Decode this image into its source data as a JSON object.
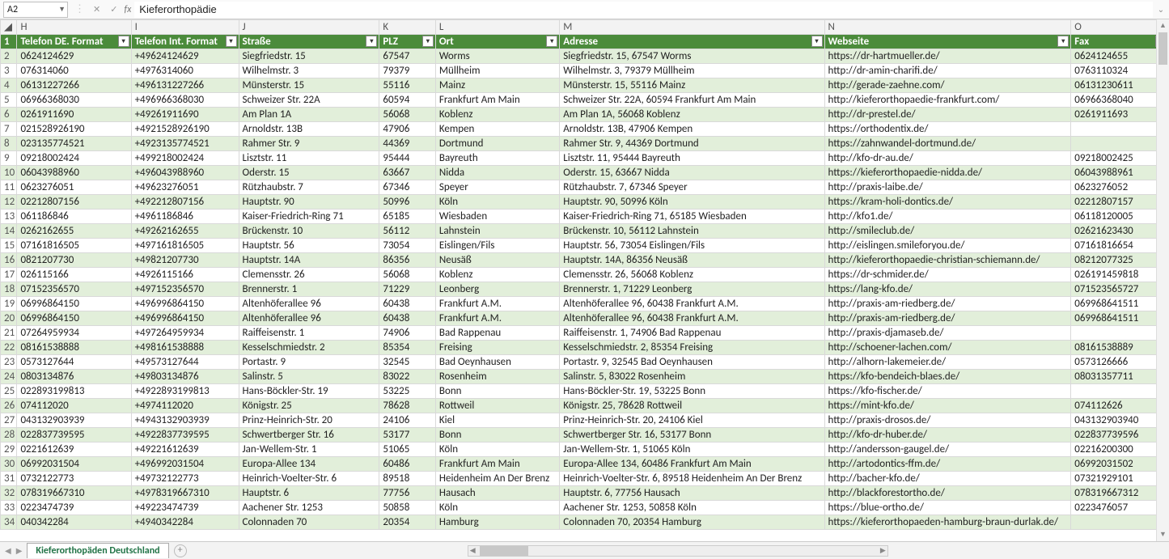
{
  "name_box": "A2",
  "formula_value": "Kieferorthopädie",
  "sheet_tab": "Kieferorthopäden Deutschland",
  "column_letters": [
    "H",
    "I",
    "J",
    "K",
    "L",
    "M",
    "N",
    "O"
  ],
  "headers": {
    "H": "Telefon DE. Format",
    "I": "Telefon Int. Format",
    "J": "Straße",
    "K": "PLZ",
    "L": "Ort",
    "M": "Adresse",
    "N": "Webseite",
    "O": "Fax"
  },
  "rows": [
    {
      "n": 2,
      "H": "0624124629",
      "I": "+49624124629",
      "J": "Siegfriedstr. 15",
      "K": "67547",
      "L": "Worms",
      "M": "Siegfriedstr. 15, 67547 Worms",
      "N": "https://dr-hartmueller.de/",
      "O": "0624124655"
    },
    {
      "n": 3,
      "H": "076314060",
      "I": "+4976314060",
      "J": "Wilhelmstr. 3",
      "K": "79379",
      "L": "Müllheim",
      "M": "Wilhelmstr. 3, 79379 Müllheim",
      "N": "http://dr-amin-charifi.de/",
      "O": "0763110324"
    },
    {
      "n": 4,
      "H": "06131227266",
      "I": "+496131227266",
      "J": "Münsterstr. 15",
      "K": "55116",
      "L": "Mainz",
      "M": "Münsterstr. 15, 55116 Mainz",
      "N": "http://gerade-zaehne.com/",
      "O": "06131230611"
    },
    {
      "n": 5,
      "H": "06966368030",
      "I": "+496966368030",
      "J": "Schweizer Str. 22A",
      "K": "60594",
      "L": "Frankfurt Am Main",
      "M": "Schweizer Str. 22A, 60594 Frankfurt Am Main",
      "N": "http://kieferorthopaedie-frankfurt.com/",
      "O": "06966368040"
    },
    {
      "n": 6,
      "H": "0261911690",
      "I": "+49261911690",
      "J": "Am Plan 1A",
      "K": "56068",
      "L": "Koblenz",
      "M": "Am Plan 1A, 56068 Koblenz",
      "N": "http://dr-prestel.de/",
      "O": "0261911693"
    },
    {
      "n": 7,
      "H": "021528926190",
      "I": "+4921528926190",
      "J": "Arnoldstr. 13B",
      "K": "47906",
      "L": "Kempen",
      "M": "Arnoldstr. 13B, 47906 Kempen",
      "N": "https://orthodentix.de/",
      "O": ""
    },
    {
      "n": 8,
      "H": "023135774521",
      "I": "+4923135774521",
      "J": "Rahmer Str. 9",
      "K": "44369",
      "L": "Dortmund",
      "M": "Rahmer Str. 9, 44369 Dortmund",
      "N": "https://zahnwandel-dortmund.de/",
      "O": ""
    },
    {
      "n": 9,
      "H": "09218002424",
      "I": "+499218002424",
      "J": "Lisztstr. 11",
      "K": "95444",
      "L": "Bayreuth",
      "M": "Lisztstr. 11, 95444 Bayreuth",
      "N": "http://kfo-dr-au.de/",
      "O": "09218002425"
    },
    {
      "n": 10,
      "H": "06043988960",
      "I": "+496043988960",
      "J": "Oderstr. 15",
      "K": "63667",
      "L": "Nidda",
      "M": "Oderstr. 15, 63667 Nidda",
      "N": "https://kieferorthopaedie-nidda.de/",
      "O": "06043988961"
    },
    {
      "n": 11,
      "H": "0623276051",
      "I": "+49623276051",
      "J": "Rützhaubstr. 7",
      "K": "67346",
      "L": "Speyer",
      "M": "Rützhaubstr. 7, 67346 Speyer",
      "N": "http://praxis-laibe.de/",
      "O": "0623276052"
    },
    {
      "n": 12,
      "H": "02212807156",
      "I": "+492212807156",
      "J": "Hauptstr. 90",
      "K": "50996",
      "L": "Köln",
      "M": "Hauptstr. 90, 50996 Köln",
      "N": "https://kram-holi-dontics.de/",
      "O": "02212807157"
    },
    {
      "n": 13,
      "H": "061186846",
      "I": "+4961186846",
      "J": "Kaiser-Friedrich-Ring 71",
      "K": "65185",
      "L": "Wiesbaden",
      "M": "Kaiser-Friedrich-Ring 71, 65185 Wiesbaden",
      "N": "http://kfo1.de/",
      "O": "06118120005"
    },
    {
      "n": 14,
      "H": "0262162655",
      "I": "+49262162655",
      "J": "Brückenstr. 10",
      "K": "56112",
      "L": "Lahnstein",
      "M": "Brückenstr. 10, 56112 Lahnstein",
      "N": "http://smileclub.de/",
      "O": "02621623430"
    },
    {
      "n": 15,
      "H": "07161816505",
      "I": "+497161816505",
      "J": "Hauptstr. 56",
      "K": "73054",
      "L": "Eislingen/Fils",
      "M": "Hauptstr. 56, 73054 Eislingen/Fils",
      "N": "http://eislingen.smileforyou.de/",
      "O": "07161816654"
    },
    {
      "n": 16,
      "H": "0821207730",
      "I": "+49821207730",
      "J": "Hauptstr. 14A",
      "K": "86356",
      "L": "Neusäß",
      "M": "Hauptstr. 14A, 86356 Neusäß",
      "N": "http://kieferorthopaedie-christian-schiemann.de/",
      "O": "08212077325"
    },
    {
      "n": 17,
      "H": "026115166",
      "I": "+4926115166",
      "J": "Clemensstr. 26",
      "K": "56068",
      "L": "Koblenz",
      "M": "Clemensstr. 26, 56068 Koblenz",
      "N": "https://dr-schmider.de/",
      "O": "026191459818"
    },
    {
      "n": 18,
      "H": "07152356570",
      "I": "+497152356570",
      "J": "Brennerstr. 1",
      "K": "71229",
      "L": "Leonberg",
      "M": "Brennerstr. 1, 71229 Leonberg",
      "N": "https://lang-kfo.de/",
      "O": "071523565727"
    },
    {
      "n": 19,
      "H": "06996864150",
      "I": "+496996864150",
      "J": "Altenhöferallee 96",
      "K": "60438",
      "L": "Frankfurt A.M.",
      "M": "Altenhöferallee 96, 60438 Frankfurt A.M.",
      "N": "http://praxis-am-riedberg.de/",
      "O": "069968641511"
    },
    {
      "n": 20,
      "H": "06996864150",
      "I": "+496996864150",
      "J": "Altenhöferallee 96",
      "K": "60438",
      "L": "Frankfurt A.M.",
      "M": "Altenhöferallee 96, 60438 Frankfurt A.M.",
      "N": "http://praxis-am-riedberg.de/",
      "O": "069968641511"
    },
    {
      "n": 21,
      "H": "07264959934",
      "I": "+497264959934",
      "J": "Raiffeisenstr. 1",
      "K": "74906",
      "L": "Bad Rappenau",
      "M": "Raiffeisenstr. 1, 74906 Bad Rappenau",
      "N": "http://praxis-djamaseb.de/",
      "O": ""
    },
    {
      "n": 22,
      "H": "08161538888",
      "I": "+498161538888",
      "J": "Kesselschmiedstr. 2",
      "K": "85354",
      "L": "Freising",
      "M": "Kesselschmiedstr. 2, 85354 Freising",
      "N": "http://schoener-lachen.com/",
      "O": "08161538889"
    },
    {
      "n": 23,
      "H": "0573127644",
      "I": "+49573127644",
      "J": "Portastr. 9",
      "K": "32545",
      "L": "Bad Oeynhausen",
      "M": "Portastr. 9, 32545 Bad Oeynhausen",
      "N": "http://alhorn-lakemeier.de/",
      "O": "0573126666"
    },
    {
      "n": 24,
      "H": "0803134876",
      "I": "+49803134876",
      "J": "Salinstr. 5",
      "K": "83022",
      "L": "Rosenheim",
      "M": "Salinstr. 5, 83022 Rosenheim",
      "N": "https://kfo-bendeich-blaes.de/",
      "O": "08031357711"
    },
    {
      "n": 25,
      "H": "022893199813",
      "I": "+4922893199813",
      "J": "Hans-Böckler-Str. 19",
      "K": "53225",
      "L": "Bonn",
      "M": "Hans-Böckler-Str. 19, 53225 Bonn",
      "N": "https://kfo-fischer.de/",
      "O": ""
    },
    {
      "n": 26,
      "H": "074112020",
      "I": "+4974112020",
      "J": "Königstr. 25",
      "K": "78628",
      "L": "Rottweil",
      "M": "Königstr. 25, 78628 Rottweil",
      "N": "https://mint-kfo.de/",
      "O": "074112626"
    },
    {
      "n": 27,
      "H": "043132903939",
      "I": "+4943132903939",
      "J": "Prinz-Heinrich-Str. 20",
      "K": "24106",
      "L": "Kiel",
      "M": "Prinz-Heinrich-Str. 20, 24106 Kiel",
      "N": "http://praxis-drosos.de/",
      "O": "043132903940"
    },
    {
      "n": 28,
      "H": "022837739595",
      "I": "+4922837739595",
      "J": "Schwertberger Str. 16",
      "K": "53177",
      "L": "Bonn",
      "M": "Schwertberger Str. 16, 53177 Bonn",
      "N": "http://kfo-dr-huber.de/",
      "O": "022837739596"
    },
    {
      "n": 29,
      "H": "0221612639",
      "I": "+49221612639",
      "J": "Jan-Wellem-Str. 1",
      "K": "51065",
      "L": "Köln",
      "M": "Jan-Wellem-Str. 1, 51065 Köln",
      "N": "http://andersson-gaugel.de/",
      "O": "02216200300"
    },
    {
      "n": 30,
      "H": "06992031504",
      "I": "+496992031504",
      "J": "Europa-Allee 134",
      "K": "60486",
      "L": "Frankfurt Am Main",
      "M": "Europa-Allee 134, 60486 Frankfurt Am Main",
      "N": "http://artodontics-ffm.de/",
      "O": "06992031502"
    },
    {
      "n": 31,
      "H": "0732122773",
      "I": "+49732122773",
      "J": "Heinrich-Voelter-Str. 6",
      "K": "89518",
      "L": "Heidenheim An Der Brenz",
      "M": "Heinrich-Voelter-Str. 6, 89518 Heidenheim An Der Brenz",
      "N": "http://bacher-kfo.de/",
      "O": "07321929101"
    },
    {
      "n": 32,
      "H": "078319667310",
      "I": "+4978319667310",
      "J": "Hauptstr. 6",
      "K": "77756",
      "L": "Hausach",
      "M": "Hauptstr. 6, 77756 Hausach",
      "N": "http://blackforestortho.de/",
      "O": "078319667312"
    },
    {
      "n": 33,
      "H": "0223474739",
      "I": "+49223474739",
      "J": "Aachener Str. 1253",
      "K": "50858",
      "L": "Köln",
      "M": "Aachener Str. 1253, 50858 Köln",
      "N": "https://blue-ortho.de/",
      "O": "0223476057"
    },
    {
      "n": 34,
      "H": "040342284",
      "I": "+4940342284",
      "J": "Colonnaden 70",
      "K": "20354",
      "L": "Hamburg",
      "M": "Colonnaden 70, 20354 Hamburg",
      "N": "https://kieferorthopaeden-hamburg-braun-durlak.de/",
      "O": ""
    }
  ]
}
